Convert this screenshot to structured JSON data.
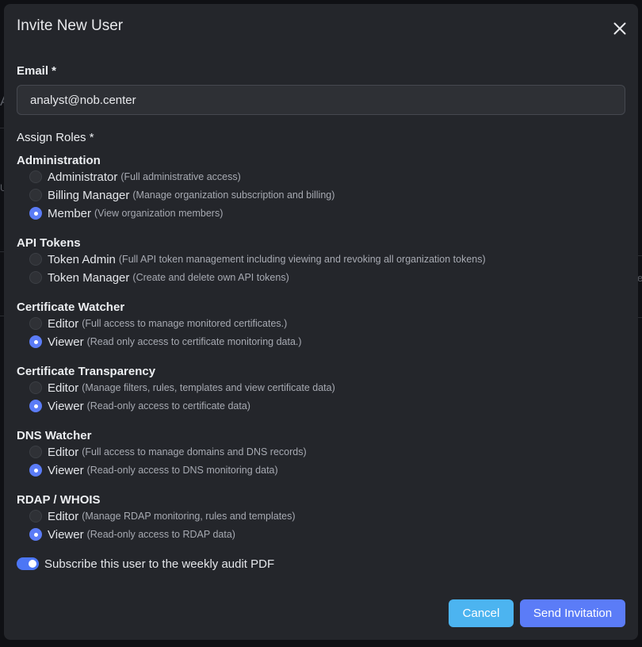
{
  "dialog": {
    "title": "Invite New User"
  },
  "email": {
    "label": "Email *",
    "value": "analyst@nob.center",
    "placeholder": ""
  },
  "roles": {
    "label": "Assign Roles *",
    "groups": [
      {
        "title": "Administration",
        "options": [
          {
            "name": "Administrator",
            "desc": "(Full administrative access)",
            "checked": false
          },
          {
            "name": "Billing Manager",
            "desc": "(Manage organization subscription and billing)",
            "checked": false
          },
          {
            "name": "Member",
            "desc": "(View organization members)",
            "checked": true
          }
        ]
      },
      {
        "title": "API Tokens",
        "options": [
          {
            "name": "Token Admin",
            "desc": "(Full API token management including viewing and revoking all organization tokens)",
            "checked": false
          },
          {
            "name": "Token Manager",
            "desc": "(Create and delete own API tokens)",
            "checked": false
          }
        ]
      },
      {
        "title": "Certificate Watcher",
        "options": [
          {
            "name": "Editor",
            "desc": "(Full access to manage monitored certificates.)",
            "checked": false
          },
          {
            "name": "Viewer",
            "desc": "(Read only access to certificate monitoring data.)",
            "checked": true
          }
        ]
      },
      {
        "title": "Certificate Transparency",
        "options": [
          {
            "name": "Editor",
            "desc": "(Manage filters, rules, templates and view certificate data)",
            "checked": false
          },
          {
            "name": "Viewer",
            "desc": "(Read-only access to certificate data)",
            "checked": true
          }
        ]
      },
      {
        "title": "DNS Watcher",
        "options": [
          {
            "name": "Editor",
            "desc": "(Full access to manage domains and DNS records)",
            "checked": false
          },
          {
            "name": "Viewer",
            "desc": "(Read-only access to DNS monitoring data)",
            "checked": true
          }
        ]
      },
      {
        "title": "RDAP / WHOIS",
        "options": [
          {
            "name": "Editor",
            "desc": "(Manage RDAP monitoring, rules and templates)",
            "checked": false
          },
          {
            "name": "Viewer",
            "desc": "(Read-only access to RDAP data)",
            "checked": true
          }
        ]
      }
    ]
  },
  "subscribe": {
    "label": "Subscribe this user to the weekly audit PDF",
    "enabled": true
  },
  "actions": {
    "cancel": "Cancel",
    "send": "Send Invitation"
  },
  "background": {
    "fragments": [
      "A",
      "U",
      "e"
    ]
  },
  "colors": {
    "accent": "#5b7cf7",
    "cancel": "#4cb4f0",
    "surface": "#24262b"
  }
}
